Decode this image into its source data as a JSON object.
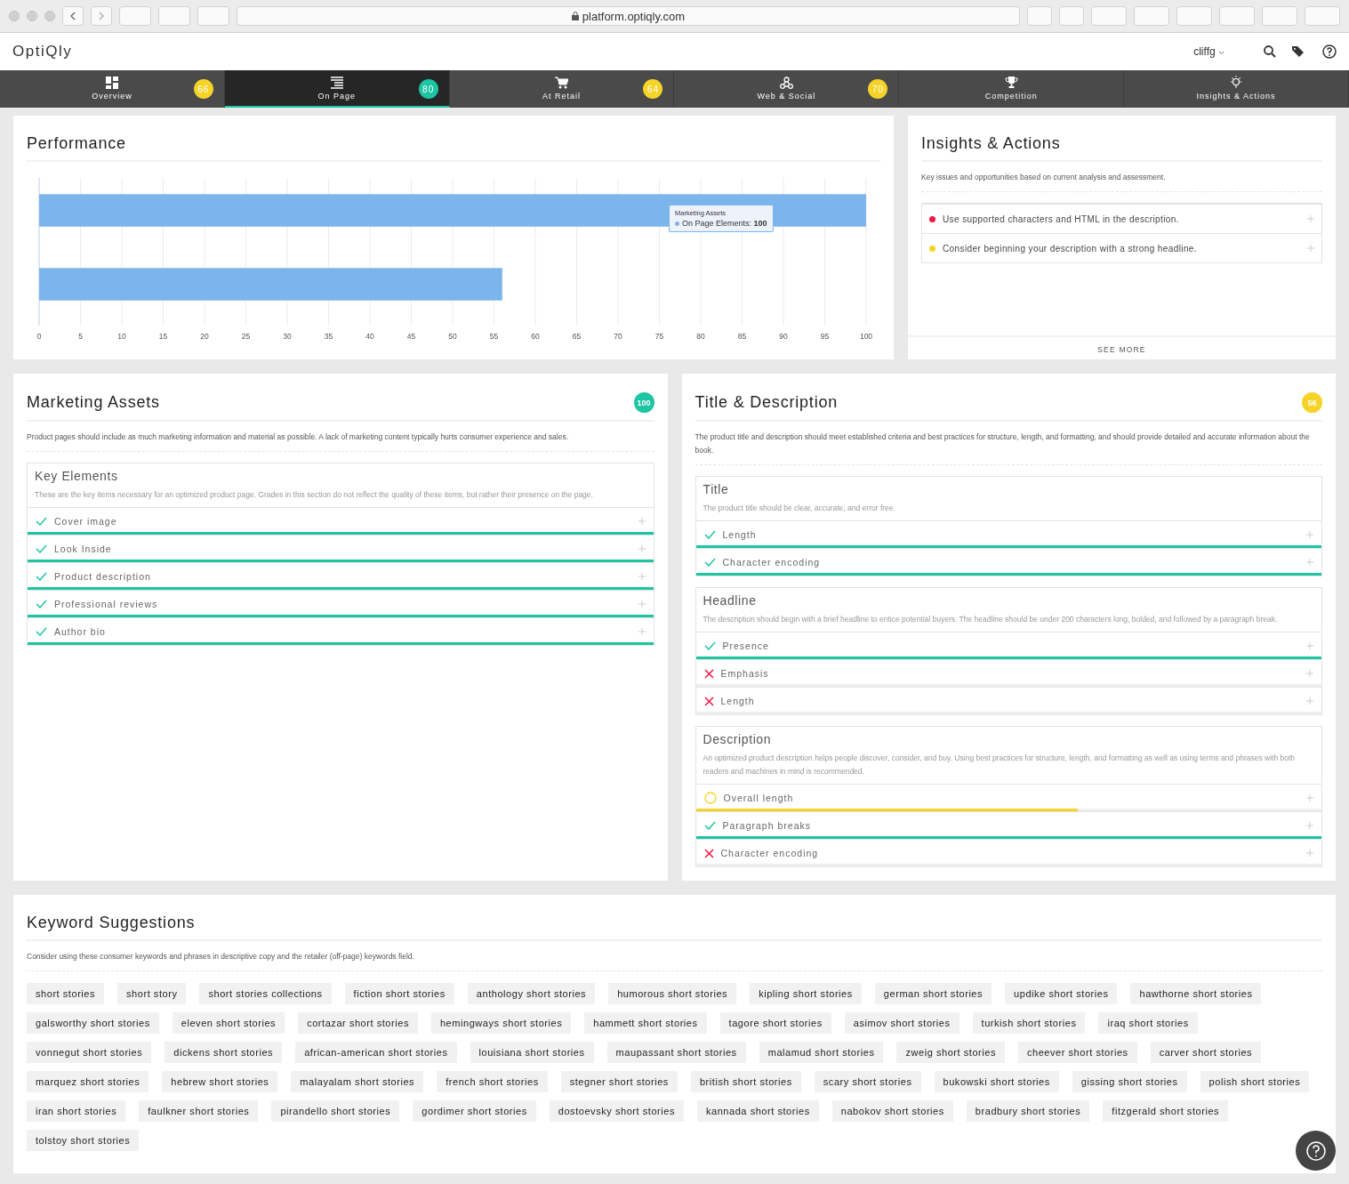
{
  "browser": {
    "url": "platform.optiqly.com"
  },
  "header": {
    "logo": "OptiQly",
    "user": "cliffg"
  },
  "nav": [
    {
      "label": "Overview",
      "score": "66",
      "color": "#f5d327",
      "selected": false
    },
    {
      "label": "On Page",
      "score": "80",
      "color": "#1dc5a3",
      "selected": true
    },
    {
      "label": "At Retail",
      "score": "64",
      "color": "#f5d327",
      "selected": false
    },
    {
      "label": "Web & Social",
      "score": "70",
      "color": "#f5d327",
      "selected": false
    },
    {
      "label": "Competition",
      "selected": false
    },
    {
      "label": "Insights & Actions",
      "selected": false
    }
  ],
  "performance": {
    "title": "Performance",
    "chart_data": {
      "type": "bar",
      "orientation": "horizontal",
      "grid": true,
      "series": [
        {
          "color": "#7cb5ec",
          "values": [
            100,
            56
          ]
        }
      ],
      "xlim": [
        0,
        100
      ],
      "xticks": [
        0,
        5,
        10,
        15,
        20,
        25,
        30,
        35,
        40,
        45,
        50,
        55,
        60,
        65,
        70,
        75,
        80,
        85,
        90,
        95,
        100
      ]
    },
    "tooltip": {
      "title": "Marketing Assets",
      "label": "On Page Elements:",
      "value": "100"
    }
  },
  "insights": {
    "title": "Insights & Actions",
    "description": "Key issues and opportunities based on current analysis and assessment.",
    "items": [
      {
        "text": "Use supported characters and HTML in the description.",
        "color": "#f0163f"
      },
      {
        "text": "Consider beginning your description with a strong headline.",
        "color": "#f5d327"
      }
    ],
    "see_more": "SEE MORE"
  },
  "marketing": {
    "title": "Marketing Assets",
    "score": "100",
    "color": "#1dc5a3",
    "description": "Product pages should include as much marketing information and material as possible. A lack of marketing content typically hurts consumer experience and sales.",
    "groups": [
      {
        "title": "Key Elements",
        "description": "These are the key items necessary for an optimized product page. Grades in this section do not reflect the quality of these items, but rather their presence on the page.",
        "checks": [
          {
            "label": "Cover image",
            "kind": "pass",
            "level": 1
          },
          {
            "label": "Look Inside",
            "kind": "pass",
            "level": 1
          },
          {
            "label": "Product description",
            "kind": "pass",
            "level": 1
          },
          {
            "label": "Professional reviews",
            "kind": "pass",
            "level": 1
          },
          {
            "label": "Author bio",
            "kind": "pass",
            "level": 1
          }
        ]
      }
    ]
  },
  "title_description": {
    "title": "Title & Description",
    "score": "56",
    "color": "#f5d327",
    "description": "The product title and description should meet established criteria and best practices for structure, length, and formatting, and should provide detailed and accurate information about the book.",
    "groups": [
      {
        "title": "Title",
        "description": "The product title should be clear, accurate, and error free.",
        "checks": [
          {
            "label": "Length",
            "kind": "pass",
            "level": 1
          },
          {
            "label": "Character encoding",
            "kind": "pass",
            "level": 1
          }
        ]
      },
      {
        "title": "Headline",
        "description": "The description should begin with a brief headline to entice potential buyers. The headline should be under 200 characters long, bolded, and followed by a paragraph break.",
        "checks": [
          {
            "label": "Presence",
            "kind": "pass",
            "level": 1
          },
          {
            "label": "Emphasis",
            "kind": "fail"
          },
          {
            "label": "Length",
            "kind": "fail"
          }
        ]
      },
      {
        "title": "Description",
        "description": "An optimized product description helps people discover, consider, and buy. Using best practices for structure, length, and formatting as well as using terms and phrases with both readers and machines in mind is recommended.",
        "checks": [
          {
            "label": "Overall length",
            "kind": "partial",
            "level": 0.61
          },
          {
            "label": "Paragraph breaks",
            "kind": "pass",
            "level": 1
          },
          {
            "label": "Character encoding",
            "kind": "fail"
          }
        ]
      }
    ]
  },
  "keywords": {
    "title": "Keyword Suggestions",
    "description": "Consider using these consumer keywords and phrases in descriptive copy and the retailer (off-page) keywords field.",
    "tags": [
      "short stories",
      "short story",
      "short stories collections",
      "fiction short stories",
      "anthology short stories",
      "humorous short stories",
      "kipling short stories",
      "german short stories",
      "updike short stories",
      "hawthorne short stories",
      "galsworthy short stories",
      "eleven short stories",
      "cortazar short stories",
      "hemingways short stories",
      "hammett short stories",
      "tagore short stories",
      "asimov short stories",
      "turkish short stories",
      "iraq short stories",
      "vonnegut short stories",
      "dickens short stories",
      "african-american short stories",
      "louisiana short stories",
      "maupassant short stories",
      "malamud short stories",
      "zweig short stories",
      "cheever short stories",
      "carver short stories",
      "marquez short stories",
      "hebrew short stories",
      "malayalam short stories",
      "french short stories",
      "stegner short stories",
      "british short stories",
      "scary short stories",
      "bukowski short stories",
      "gissing short stories",
      "polish short stories",
      "iran short stories",
      "faulkner short stories",
      "pirandello short stories",
      "gordimer short stories",
      "dostoevsky short stories",
      "kannada short stories",
      "nabokov short stories",
      "bradbury short stories",
      "fitzgerald short stories",
      "tolstoy short stories"
    ]
  }
}
